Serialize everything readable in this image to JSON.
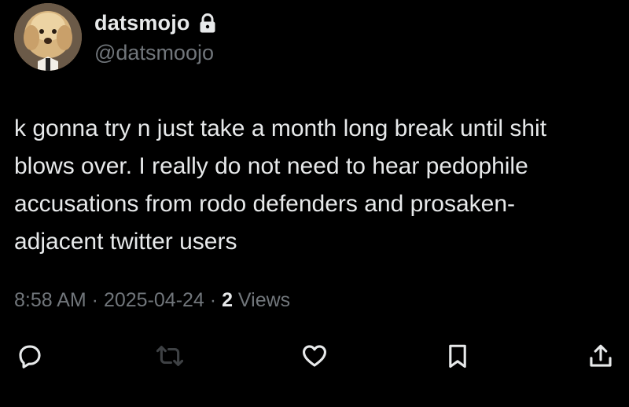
{
  "author": {
    "display_name": "datsmojo",
    "handle": "@datsmoojo",
    "protected_icon": "lock-icon",
    "avatar": "profile-photo"
  },
  "tweet": {
    "text": "k gonna try n just take a month long break until shit\nblows over. I really do not need to hear pedophile\naccusations from rodo defenders and prosaken-\nadjacent twitter users"
  },
  "meta": {
    "time": "8:58 AM",
    "sep1": " · ",
    "date": "2025-04-24",
    "sep2": " · ",
    "views_count": "2",
    "views_label": " Views"
  },
  "actions": [
    {
      "icon": "reply-icon"
    },
    {
      "icon": "retweet-icon"
    },
    {
      "icon": "like-icon"
    },
    {
      "icon": "bookmark-icon"
    },
    {
      "icon": "share-icon"
    }
  ],
  "colors": {
    "background": "#000000",
    "primary_text": "#e7e9ea",
    "secondary_text": "#71767b",
    "retweet_disabled": "#3e4144"
  }
}
